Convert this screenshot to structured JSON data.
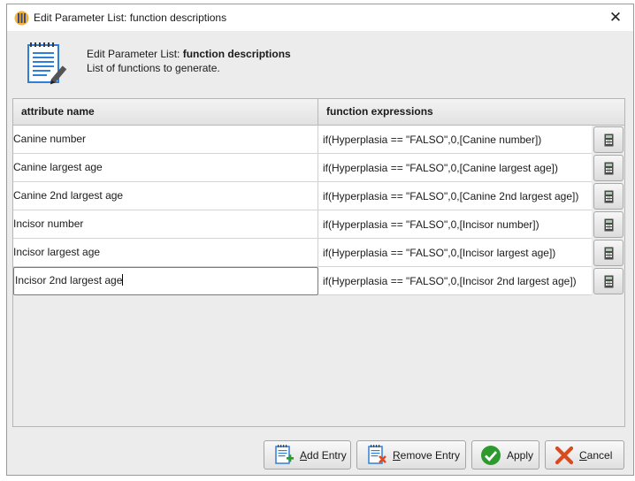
{
  "window": {
    "title": "Edit Parameter List: function descriptions",
    "close_glyph": "✕"
  },
  "header": {
    "title_prefix": "Edit Parameter List: ",
    "title_bold": "function descriptions",
    "subtitle": "List of functions to generate."
  },
  "table": {
    "columns": [
      "attribute name",
      "function expressions"
    ],
    "rows": [
      {
        "name": "Canine number",
        "expr": "if(Hyperplasia == \"FALSO\",0,[Canine number])"
      },
      {
        "name": "Canine largest age",
        "expr": "if(Hyperplasia == \"FALSO\",0,[Canine largest age])"
      },
      {
        "name": "Canine 2nd largest age",
        "expr": "if(Hyperplasia == \"FALSO\",0,[Canine 2nd largest age])"
      },
      {
        "name": "Incisor number",
        "expr": "if(Hyperplasia == \"FALSO\",0,[Incisor number])"
      },
      {
        "name": "Incisor largest age",
        "expr": "if(Hyperplasia == \"FALSO\",0,[Incisor largest age])"
      },
      {
        "name": "Incisor 2nd largest age",
        "expr": "if(Hyperplasia == \"FALSO\",0,[Incisor 2nd largest age])"
      }
    ],
    "editing_row": 5
  },
  "buttons": {
    "add_accel": "A",
    "add_rest": "dd Entry",
    "remove_accel": "R",
    "remove_rest": "emove Entry",
    "apply": "Apply",
    "cancel_accel": "C",
    "cancel_rest": "ancel"
  },
  "icons": {
    "app": "app-icon",
    "header": "document-edit-icon",
    "calculator": "calculator-icon",
    "add": "add-document-icon",
    "remove": "remove-document-icon",
    "apply": "check-icon",
    "cancel": "x-icon"
  },
  "colors": {
    "apply_green": "#2e9a2e",
    "cancel_red": "#d94a1e",
    "doc_blue": "#2f7fd6"
  }
}
